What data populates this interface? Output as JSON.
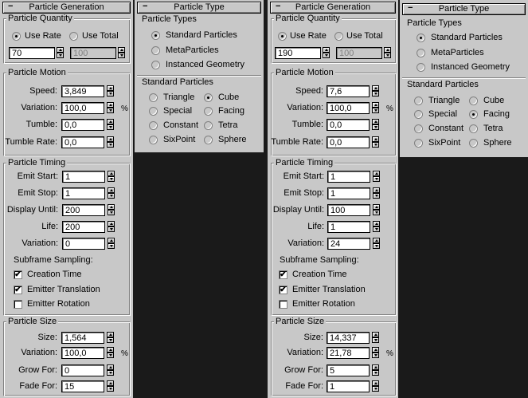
{
  "left": {
    "gen_header": "Particle Generation",
    "quantity_title": "Particle Quantity",
    "use_rate": "Use Rate",
    "use_total": "Use Total",
    "rate_value": "70",
    "total_value": "100",
    "motion_title": "Particle Motion",
    "speed_label": "Speed:",
    "speed": "3,849",
    "variation_label": "Variation:",
    "variation": "100,0",
    "tumble_label": "Tumble:",
    "tumble": "0,0",
    "tumble_rate_label": "Tumble Rate:",
    "tumble_rate": "0,0",
    "timing_title": "Particle Timing",
    "emit_start_label": "Emit Start:",
    "emit_start": "1",
    "emit_stop_label": "Emit Stop:",
    "emit_stop": "1",
    "display_until_label": "Display Until:",
    "display_until": "200",
    "life_label": "Life:",
    "life": "200",
    "tvariation_label": "Variation:",
    "tvariation": "0",
    "subframe_label": "Subframe Sampling:",
    "creation_time": "Creation Time",
    "emitter_translation": "Emitter Translation",
    "emitter_rotation": "Emitter Rotation",
    "size_title": "Particle Size",
    "size_label": "Size:",
    "size": "1,564",
    "svariation_label": "Variation:",
    "svariation": "100,0",
    "grow_label": "Grow For:",
    "grow": "0",
    "fade_label": "Fade For:",
    "fade": "15",
    "type_header": "Particle Type",
    "types_title": "Particle Types",
    "standard": "Standard Particles",
    "meta": "MetaParticles",
    "instanced": "Instanced Geometry",
    "std_title": "Standard Particles",
    "triangle": "Triangle",
    "cube": "Cube",
    "special": "Special",
    "facing": "Facing",
    "constant": "Constant",
    "tetra": "Tetra",
    "sixpoint": "SixPoint",
    "sphere": "Sphere",
    "pct": "%"
  },
  "right": {
    "gen_header": "Particle Generation",
    "quantity_title": "Particle Quantity",
    "use_rate": "Use Rate",
    "use_total": "Use Total",
    "rate_value": "190",
    "total_value": "100",
    "motion_title": "Particle Motion",
    "speed_label": "Speed:",
    "speed": "7,6",
    "variation_label": "Variation:",
    "variation": "100,0",
    "tumble_label": "Tumble:",
    "tumble": "0,0",
    "tumble_rate_label": "Tumble Rate:",
    "tumble_rate": "0,0",
    "timing_title": "Particle Timing",
    "emit_start_label": "Emit Start:",
    "emit_start": "1",
    "emit_stop_label": "Emit Stop:",
    "emit_stop": "1",
    "display_until_label": "Display Until:",
    "display_until": "100",
    "life_label": "Life:",
    "life": "1",
    "tvariation_label": "Variation:",
    "tvariation": "24",
    "subframe_label": "Subframe Sampling:",
    "creation_time": "Creation Time",
    "emitter_translation": "Emitter Translation",
    "emitter_rotation": "Emitter Rotation",
    "size_title": "Particle Size",
    "size_label": "Size:",
    "size": "14,337",
    "svariation_label": "Variation:",
    "svariation": "21,78",
    "grow_label": "Grow For:",
    "grow": "5",
    "fade_label": "Fade For:",
    "fade": "1",
    "type_header": "Particle Type",
    "types_title": "Particle Types",
    "standard": "Standard Particles",
    "meta": "MetaParticles",
    "instanced": "Instanced Geometry",
    "std_title": "Standard Particles",
    "triangle": "Triangle",
    "cube": "Cube",
    "special": "Special",
    "facing": "Facing",
    "constant": "Constant",
    "tetra": "Tetra",
    "sixpoint": "SixPoint",
    "sphere": "Sphere",
    "pct": "%"
  },
  "state": {
    "left_shape": "cube",
    "right_shape": "facing",
    "creation_time_checked": true,
    "emitter_translation_checked": true,
    "emitter_rotation_checked": false
  },
  "colors": {
    "panel": "#c8c8c8",
    "background": "#1a1a1a"
  },
  "icons": [
    "spinner-icon",
    "minus-icon"
  ]
}
